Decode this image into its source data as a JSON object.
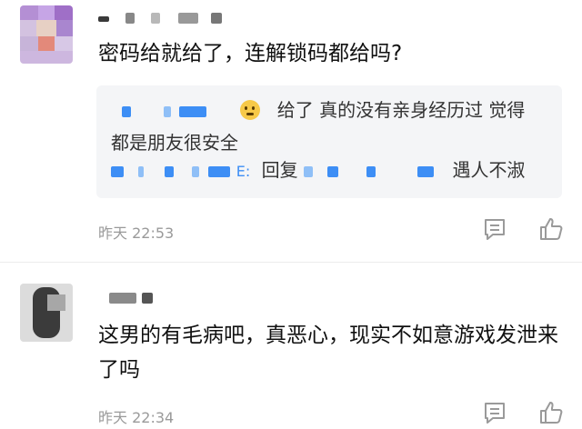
{
  "comments": [
    {
      "content": "密码给就给了，连解锁码都给吗?",
      "reply": {
        "line1_text": "给了 真的没有亲身经历过 觉得",
        "line2_text": "都是朋友很安全",
        "line3_prefix": "E:",
        "line3_reply_word": "回复",
        "line3_suffix": "遇人不淑"
      },
      "time": "昨天 22:53"
    },
    {
      "content": "这男的有毛病吧，真恶心，现实不如意游戏发泄来了吗",
      "time": "昨天 22:34"
    }
  ],
  "icons": {
    "comment": "comment-icon",
    "like": "thumbs-up-icon",
    "emoji": "emoji-icon"
  },
  "colors": {
    "blur_blue": "#3d8ef5",
    "meta_gray": "#9a9a9a",
    "reply_bg": "#f4f5f7"
  }
}
